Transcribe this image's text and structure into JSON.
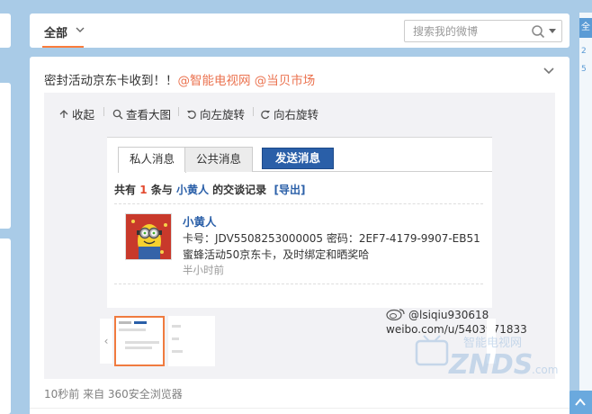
{
  "filter": {
    "all_label": "全部",
    "search_placeholder": "搜索我的微博"
  },
  "post": {
    "text_main": "密封活动京东卡收到！！",
    "mention_1": "@智能电视网",
    "mention_2": "@当贝市场",
    "footer": "10秒前 来自 360安全浏览器"
  },
  "toolbar": {
    "collapse": "收起",
    "view_large": "查看大图",
    "rotate_left": "向左旋转",
    "rotate_right": "向右旋转"
  },
  "screenshot": {
    "tab_private": "私人消息",
    "tab_public": "公共消息",
    "send_button": "发送消息",
    "summary_prefix": "共有",
    "summary_count": "1",
    "summary_mid": "条与",
    "summary_user": "小黄人",
    "summary_suffix": "的交谈记录",
    "export_link": "[导出]",
    "sender": "小黄人",
    "line_card": "卡号：JDV5508253000005 密码：2EF7-4179-9907-EB51",
    "line_desc": "蜜蜂活动50京东卡，及时绑定和晒奖哈",
    "time": "半小时前"
  },
  "watermark": {
    "handle": "@lsiqiu930618",
    "url": "weibo.com/u/5403971833",
    "znds_cn": "智能电视网",
    "znds_en": "ZNDS",
    "znds_com": ".com"
  },
  "right_panel": {
    "tab_char": "全",
    "mini_1": "2",
    "mini_2": "5"
  },
  "colors": {
    "page_bg": "#a9cbe7",
    "mention": "#eb7350",
    "accent_orange": "#fa7d3c",
    "send_blue": "#2a5fa8",
    "count_red": "#e34a2f"
  }
}
